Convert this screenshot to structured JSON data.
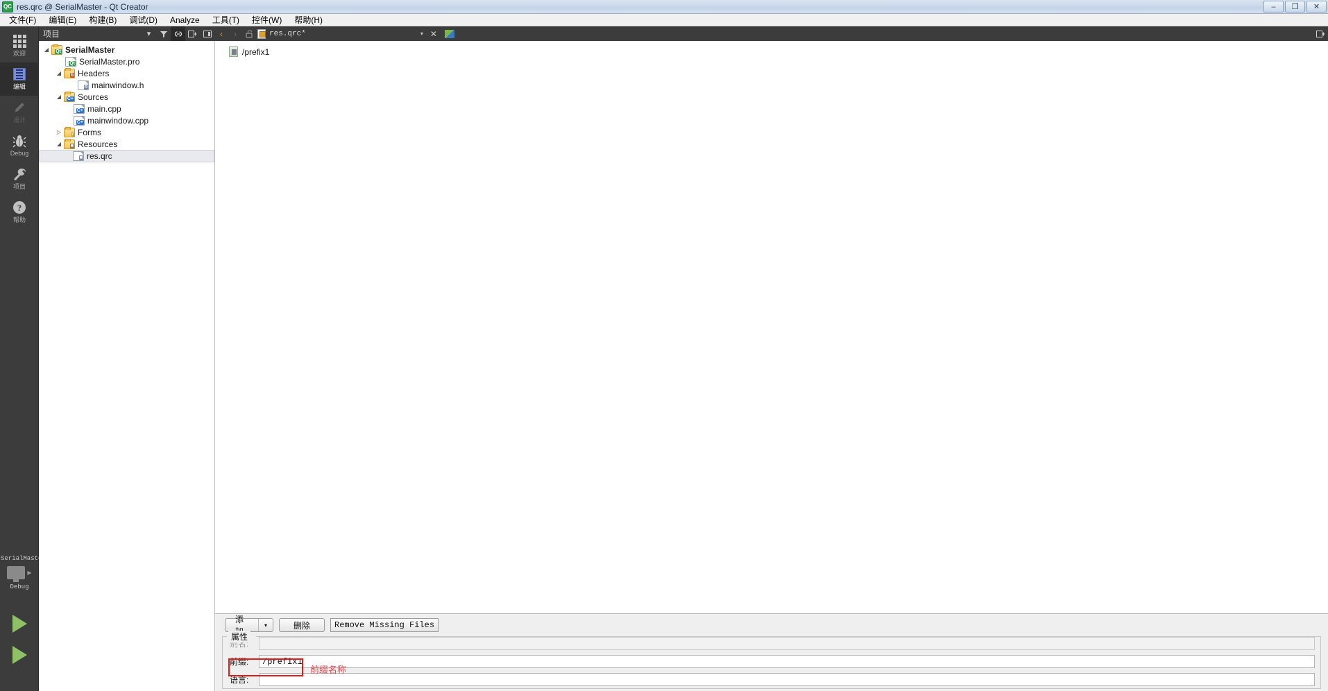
{
  "window": {
    "title": "res.qrc @ SerialMaster - Qt Creator",
    "app_icon": "QC",
    "buttons": {
      "minimize": "–",
      "restore": "❐",
      "close": "✕"
    }
  },
  "menubar": {
    "items": [
      {
        "label": "文件(F)"
      },
      {
        "label": "编辑(E)"
      },
      {
        "label": "构建(B)"
      },
      {
        "label": "调试(D)"
      },
      {
        "label": "Analyze"
      },
      {
        "label": "工具(T)"
      },
      {
        "label": "控件(W)"
      },
      {
        "label": "帮助(H)"
      }
    ]
  },
  "modebar": {
    "modes": [
      {
        "label": "欢迎",
        "icon": "grid-icon",
        "state": "normal"
      },
      {
        "label": "编辑",
        "icon": "edit-icon",
        "state": "selected"
      },
      {
        "label": "设计",
        "icon": "pencil-icon",
        "state": "disabled"
      },
      {
        "label": "Debug",
        "icon": "bug-icon",
        "state": "normal"
      },
      {
        "label": "项目",
        "icon": "wrench-icon",
        "state": "normal"
      },
      {
        "label": "帮助",
        "icon": "help-icon",
        "state": "normal"
      }
    ],
    "kit": {
      "project": "SerialMaster",
      "build_config": "Debug",
      "target_icon": "monitor-icon",
      "run_label": "▶",
      "debug_label": "▶"
    }
  },
  "project_panel": {
    "header": {
      "title": "项目",
      "caret": "▾",
      "filter_icon": "filter-icon",
      "sync_icon": "link-icon",
      "split_icon": "split-icon",
      "close_icon": "close-panel-icon"
    },
    "tree": [
      {
        "label": "SerialMaster",
        "indent": 0,
        "arrow": "open",
        "icon": "qt-project-folder-icon",
        "bold": true,
        "selected": false
      },
      {
        "label": "SerialMaster.pro",
        "indent": 1,
        "arrow": "none",
        "icon": "qt-pro-file-icon",
        "bold": false,
        "selected": false
      },
      {
        "label": "Headers",
        "indent": 1,
        "arrow": "open",
        "icon": "headers-folder-icon",
        "bold": false,
        "selected": false
      },
      {
        "label": "mainwindow.h",
        "indent": 2,
        "arrow": "none",
        "icon": "header-file-icon",
        "bold": false,
        "selected": false
      },
      {
        "label": "Sources",
        "indent": 1,
        "arrow": "open",
        "icon": "sources-folder-icon",
        "bold": false,
        "selected": false
      },
      {
        "label": "main.cpp",
        "indent": 2,
        "arrow": "none",
        "icon": "cpp-file-icon",
        "bold": false,
        "selected": false
      },
      {
        "label": "mainwindow.cpp",
        "indent": 2,
        "arrow": "none",
        "icon": "cpp-file-icon",
        "bold": false,
        "selected": false
      },
      {
        "label": "Forms",
        "indent": 1,
        "arrow": "closed",
        "icon": "forms-folder-icon",
        "bold": false,
        "selected": false
      },
      {
        "label": "Resources",
        "indent": 1,
        "arrow": "open",
        "icon": "resources-folder-icon",
        "bold": false,
        "selected": false
      },
      {
        "label": "res.qrc",
        "indent": 2,
        "arrow": "none",
        "icon": "qrc-file-icon",
        "bold": false,
        "selected": true
      }
    ]
  },
  "editor": {
    "toolbar": {
      "back": "‹",
      "forward": "›",
      "lock_icon": "unlock-icon",
      "file_icon": "qrc-file-icon",
      "filename": "res.qrc*",
      "dropdown": "▾",
      "close": "✕",
      "split_icon": "split-editor-icon"
    },
    "content": {
      "nodes": [
        {
          "label": "/prefix1",
          "icon": "prefix-icon"
        }
      ]
    }
  },
  "bottom_pane": {
    "buttons": {
      "add": {
        "label": "添加",
        "caret": "▾"
      },
      "remove": {
        "label": "删除"
      },
      "remove_missing": {
        "label": "Remove Missing Files"
      }
    },
    "properties": {
      "group_title": "属性",
      "fields": [
        {
          "label": "别名:",
          "value": "",
          "disabled": true,
          "highlighted": false
        },
        {
          "label": "前缀:",
          "value": "/prefix1",
          "disabled": false,
          "highlighted": true
        },
        {
          "label": "语言:",
          "value": "",
          "disabled": false,
          "highlighted": false
        }
      ]
    },
    "annotation": {
      "text": "前缀名称",
      "color": "#e8484f"
    }
  }
}
